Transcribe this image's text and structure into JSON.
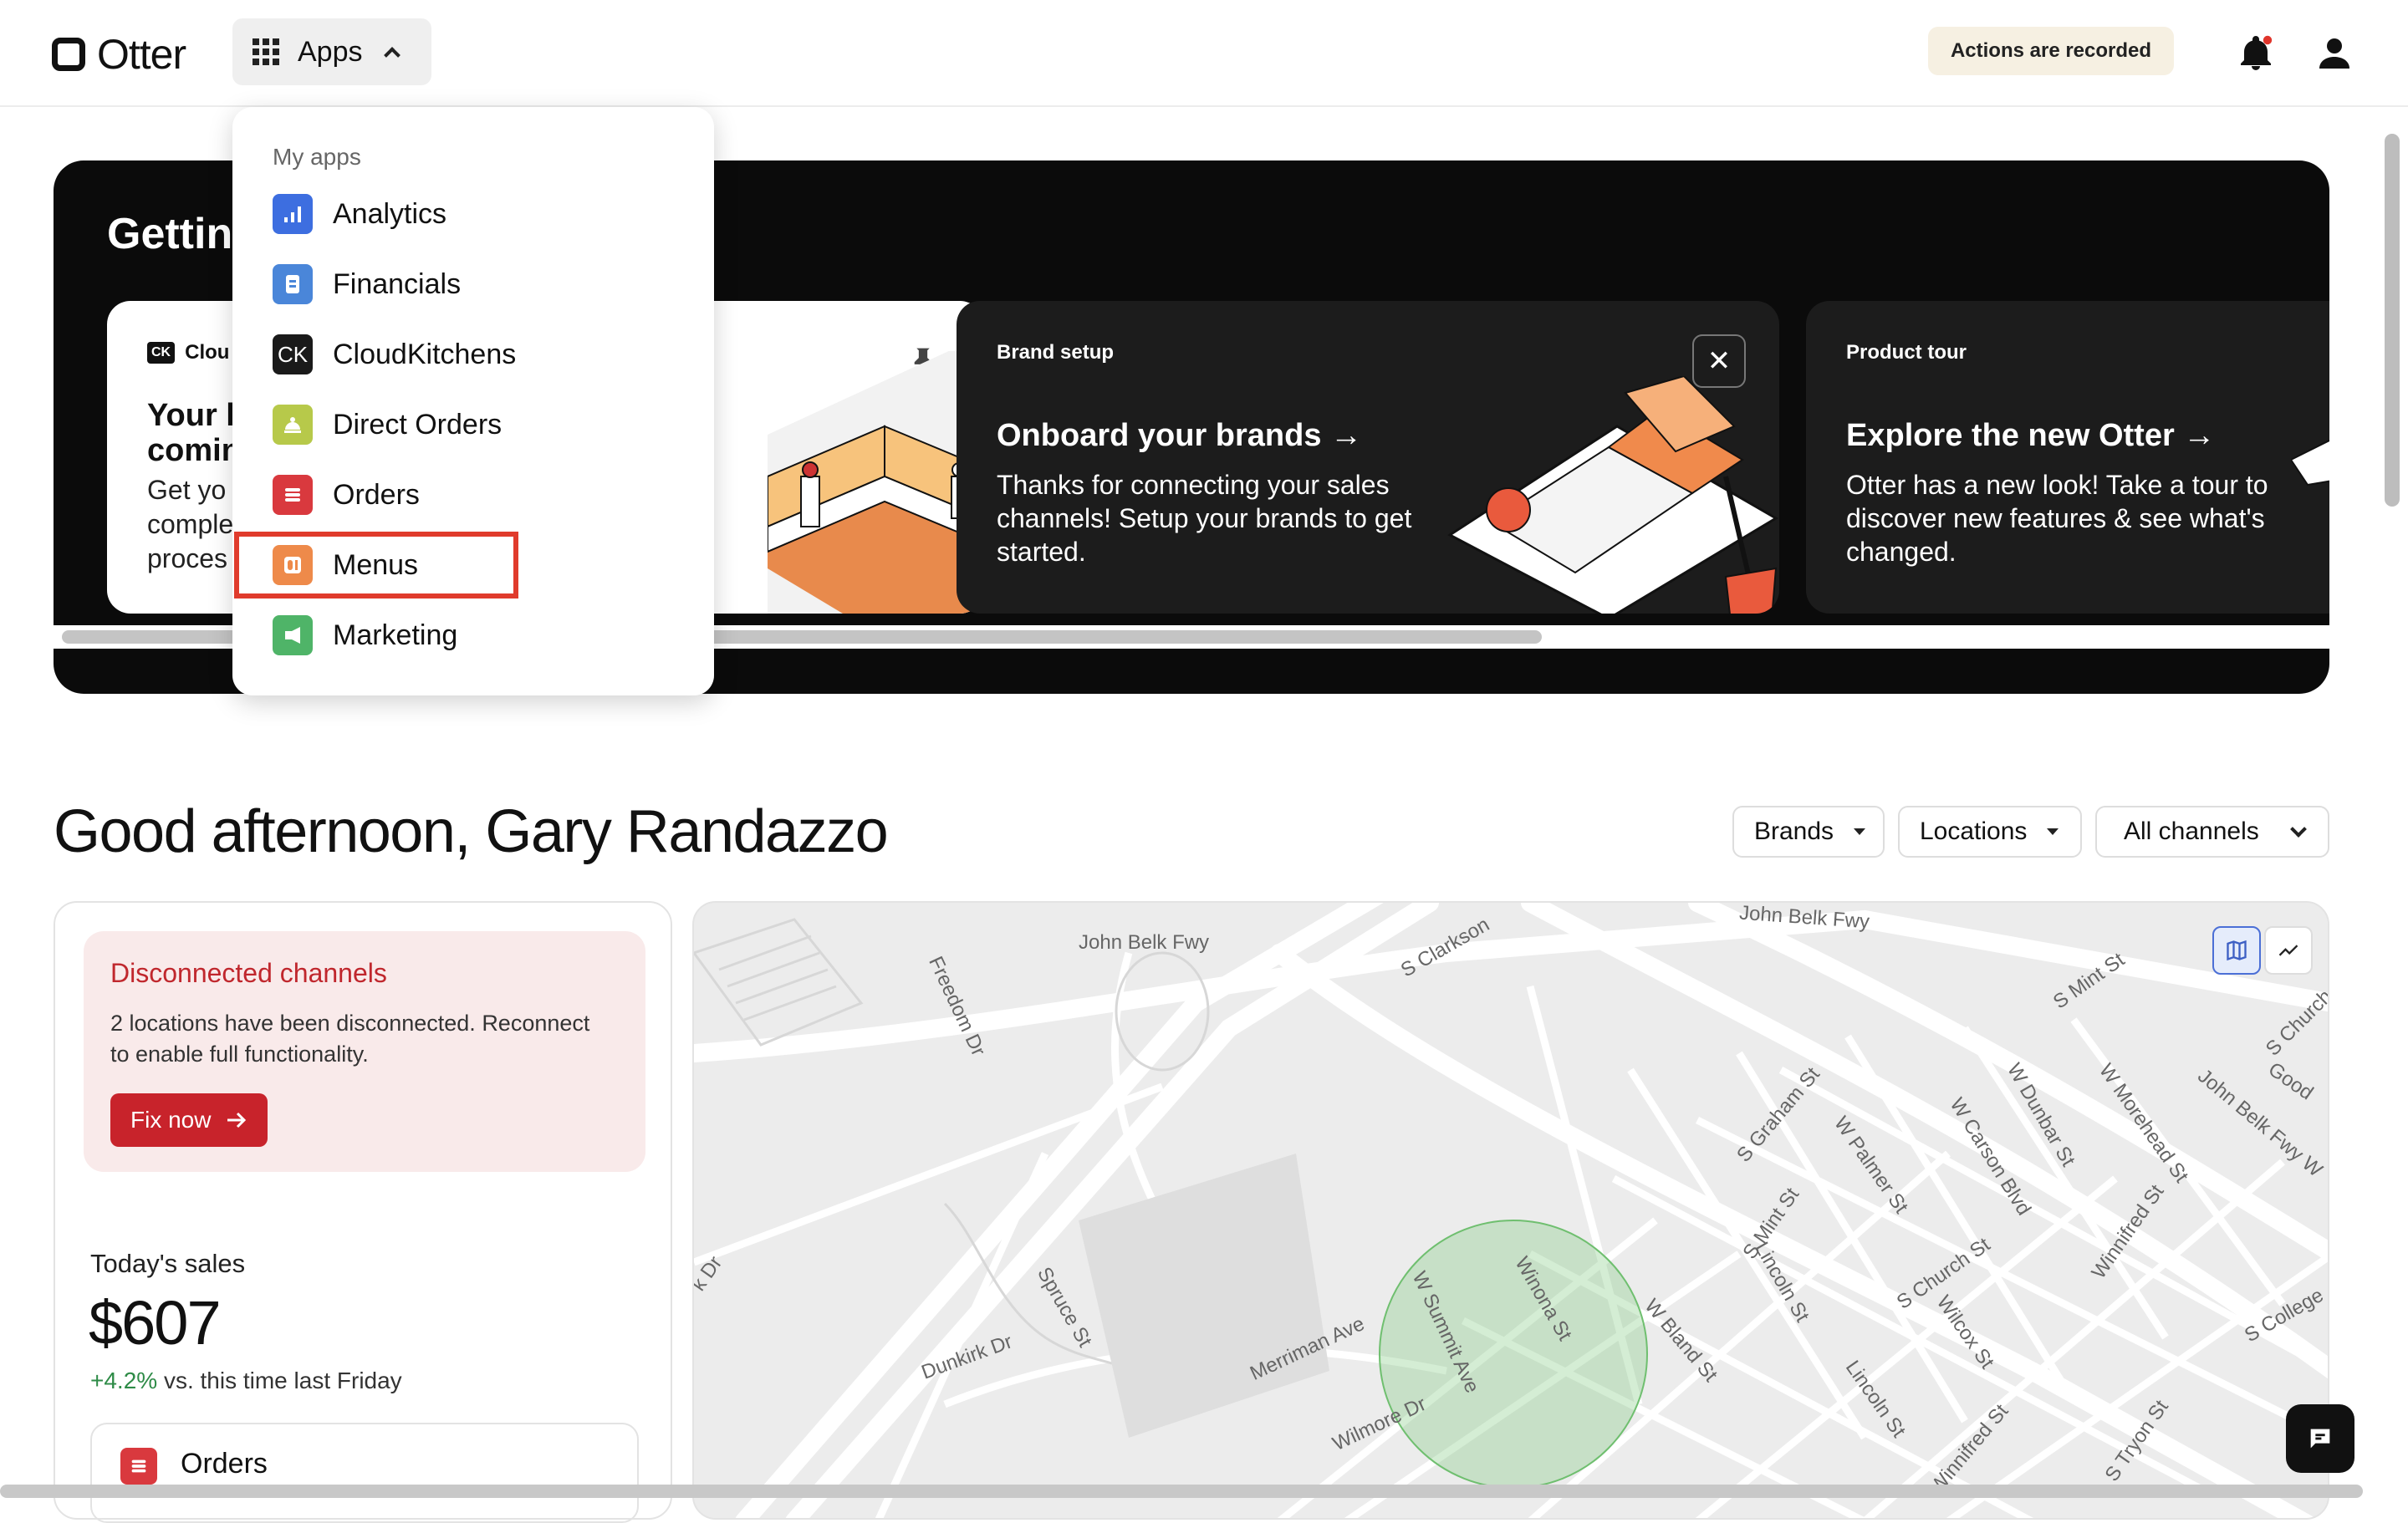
{
  "header": {
    "logo_text": "Otter",
    "apps_label": "Apps",
    "recorded_badge": "Actions are recorded"
  },
  "banner": {
    "title_partial": "Getting",
    "card1": {
      "tag": "Clou",
      "tag_icon": "CK",
      "heading_line1": "Your li",
      "heading_line2": "comin",
      "body_line1": "Get yo",
      "body_line2": "comple",
      "body_line3": "proces"
    },
    "card2": {
      "tag": "Brand setup",
      "heading": "Onboard your brands →",
      "body": "Thanks for connecting your sales channels! Setup your brands to get started."
    },
    "card3": {
      "tag": "Product tour",
      "heading": "Explore the new Otter →",
      "body": "Otter has a new look! Take a tour to discover new features & see what's changed."
    }
  },
  "apps_menu": {
    "heading": "My apps",
    "items": [
      {
        "label": "Analytics",
        "color": "#3d6ee0",
        "icon": "analytics-icon"
      },
      {
        "label": "Financials",
        "color": "#4a86d9",
        "icon": "financials-icon"
      },
      {
        "label": "CloudKitchens",
        "color": "#1a1a1a",
        "icon": "cloudkitchens-icon",
        "glyph": "CK"
      },
      {
        "label": "Direct Orders",
        "color": "#b7c94a",
        "icon": "direct-orders-icon"
      },
      {
        "label": "Orders",
        "color": "#d9393e",
        "icon": "orders-icon"
      },
      {
        "label": "Menus",
        "color": "#ee8a4a",
        "icon": "menus-icon"
      },
      {
        "label": "Marketing",
        "color": "#4fb468",
        "icon": "marketing-icon"
      }
    ],
    "highlighted": "Menus"
  },
  "greeting": "Good afternoon, Gary Randazzo",
  "filters": {
    "brands": "Brands",
    "locations": "Locations",
    "channels": "All channels"
  },
  "alert": {
    "title": "Disconnected channels",
    "message": "2 locations have been disconnected. Reconnect to enable full functionality.",
    "button": "Fix now"
  },
  "sales": {
    "label": "Today's sales",
    "value": "$607",
    "delta": "+4.2%",
    "delta_suffix": " vs. this time last Friday"
  },
  "orders_card": {
    "label": "Orders"
  },
  "map": {
    "streets": [
      "John Belk Fwy",
      "John Belk Fwy",
      "S Clarkson",
      "Freedom Dr",
      "S Mint St",
      "S Church",
      "Good",
      "S Graham St",
      "W Dunbar St",
      "W Morehead St",
      "John Belk Fwy W",
      "W Palmer St",
      "W Carson Blvd",
      "S Mint St",
      "Lincoln St",
      "S Church St",
      "Winnifred St",
      "S College",
      "Spruce St",
      "Dunkirk Dr",
      "Merriman Ave",
      "W Summit Ave",
      "Winona St",
      "W Bland St",
      "Wilcox St",
      "Lincoln St",
      "Winnifred St",
      "S Tryon St",
      "Wilmore Dr",
      "k Dr"
    ]
  },
  "colors": {
    "accent_red": "#c8232b",
    "highlight_frame": "#e03b2c",
    "positive": "#2e8b47"
  }
}
